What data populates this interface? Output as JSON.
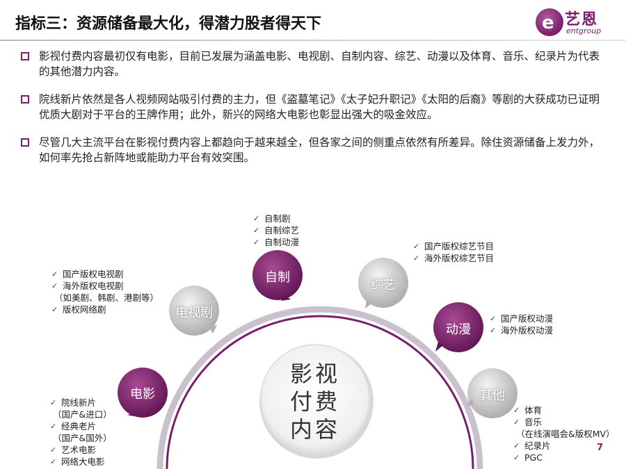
{
  "title": "指标三：资源储备最大化，得潜力股者得天下",
  "logo": {
    "cn": "艺恩",
    "en": "entgroup",
    "mark": "e"
  },
  "bullets": [
    "影视付费内容最初仅有电影，目前已发展为涵盖电影、电视剧、自制内容、综艺、动漫以及体育、音乐、纪录片为代表的其他潜力内容。",
    "院线新片依然是各人视频网站吸引付费的主力，但《盗墓笔记》《太子妃升职记》《太阳的后裔》等剧的大获成功已证明优质大剧对于平台的王牌作用；此外，新兴的网络大电影也彰显出强大的吸金效应。",
    "尽管几大主流平台在影视付费内容上都趋向于越来越全，但各家之间的侧重点依然有所差异。除住资源储备上发力外，如何率先抢占新阵地或能助力平台有效突围。"
  ],
  "center": {
    "lines": [
      "影视",
      "付费",
      "内容"
    ]
  },
  "categories": {
    "movie": {
      "label": "电影",
      "items": [
        {
          "t": "院线新片",
          "check": true
        },
        {
          "t": "（国产&进口）",
          "check": false
        },
        {
          "t": "经典老片",
          "check": true
        },
        {
          "t": "（国产&国外）",
          "check": false
        },
        {
          "t": "艺术电影",
          "check": true
        },
        {
          "t": "网络大电影",
          "check": true
        }
      ]
    },
    "tv": {
      "label": "电视剧",
      "items": [
        {
          "t": "国产版权电视剧",
          "check": true
        },
        {
          "t": "海外版权电视剧",
          "check": true
        },
        {
          "t": "（如美剧、韩剧、港剧等）",
          "check": false
        },
        {
          "t": "版权网络剧",
          "check": true
        }
      ]
    },
    "original": {
      "label": "自制",
      "items": [
        {
          "t": "自制剧",
          "check": true
        },
        {
          "t": "自制综艺",
          "check": true
        },
        {
          "t": "自制动漫",
          "check": true
        }
      ]
    },
    "variety": {
      "label": "综艺",
      "items": [
        {
          "t": "国产版权综艺节目",
          "check": true
        },
        {
          "t": "海外版权综艺节目",
          "check": true
        }
      ]
    },
    "anime": {
      "label": "动漫",
      "items": [
        {
          "t": "国产版权动漫",
          "check": true
        },
        {
          "t": "海外版权动漫",
          "check": true
        }
      ]
    },
    "other": {
      "label": "其他",
      "items": [
        {
          "t": "体育",
          "check": true
        },
        {
          "t": "音乐",
          "check": true
        },
        {
          "t": "（在线演唱会&版权MV）",
          "check": false
        },
        {
          "t": "纪录片",
          "check": true
        },
        {
          "t": "PGC",
          "check": true
        }
      ]
    }
  },
  "check_glyph": "✓",
  "page_number": "7",
  "colors": {
    "accent": "#7a1d6a",
    "gray_bubble": "#bdbdbd"
  }
}
